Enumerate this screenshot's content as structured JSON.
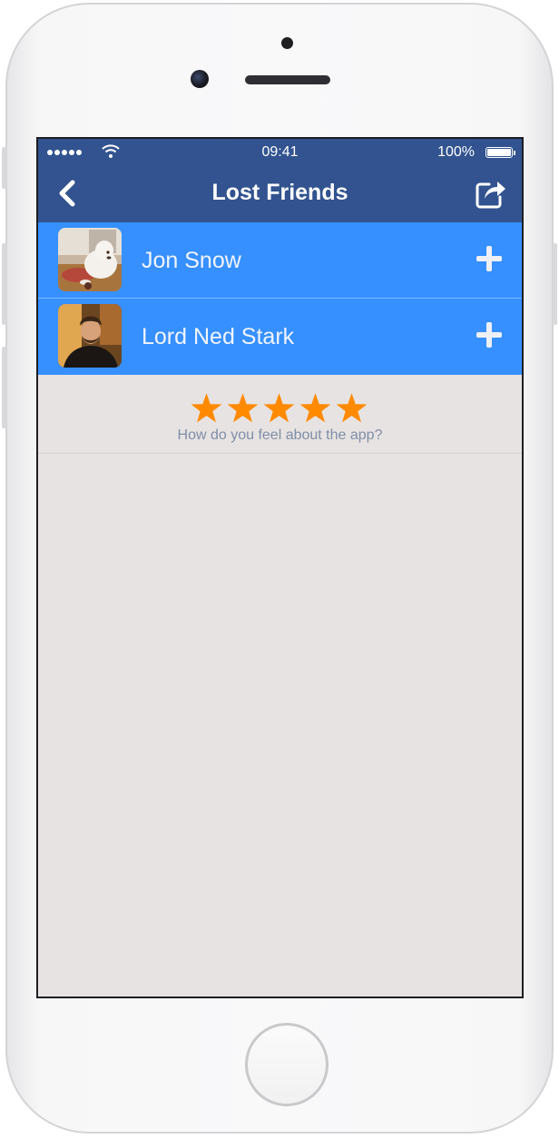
{
  "status_bar": {
    "time": "09:41",
    "battery": "100%"
  },
  "header": {
    "title": "Lost Friends"
  },
  "friends": [
    {
      "name": "Jon Snow",
      "avatar": "dog-photo"
    },
    {
      "name": "Lord Ned Stark",
      "avatar": "man-photo"
    }
  ],
  "rating": {
    "prompt": "How do you feel about the app?",
    "stars": 5,
    "star_color": "#ff8a00"
  },
  "colors": {
    "nav": "#32538f",
    "row": "#3690ff",
    "background": "#e7e3e2"
  }
}
